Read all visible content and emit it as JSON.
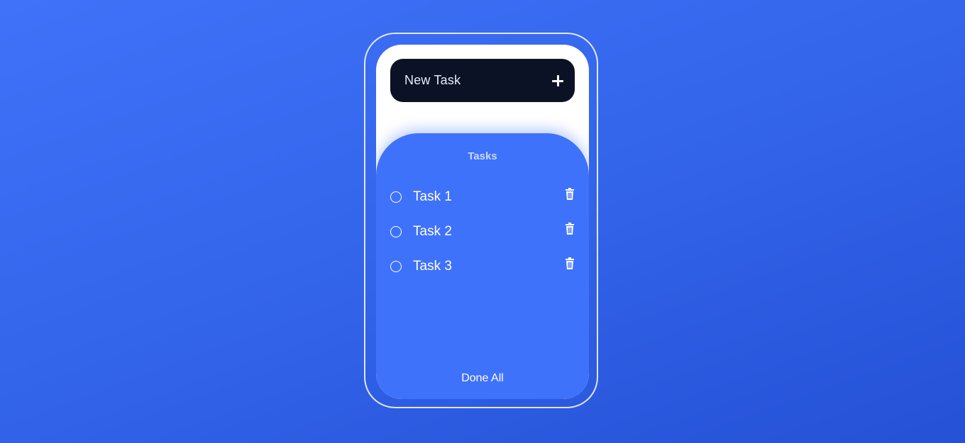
{
  "new_task": {
    "label": "New Task",
    "icon": "plus-icon"
  },
  "tasks_panel": {
    "title": "Tasks",
    "items": [
      {
        "label": "Task 1",
        "completed": false
      },
      {
        "label": "Task 2",
        "completed": false
      },
      {
        "label": "Task 3",
        "completed": false
      }
    ],
    "done_all_label": "Done All"
  },
  "colors": {
    "background_start": "#3f72f8",
    "background_end": "#2551d6",
    "new_task_bar": "#0b1226",
    "tasks_panel": "#3f72fb",
    "phone_screen": "#ffffff"
  }
}
